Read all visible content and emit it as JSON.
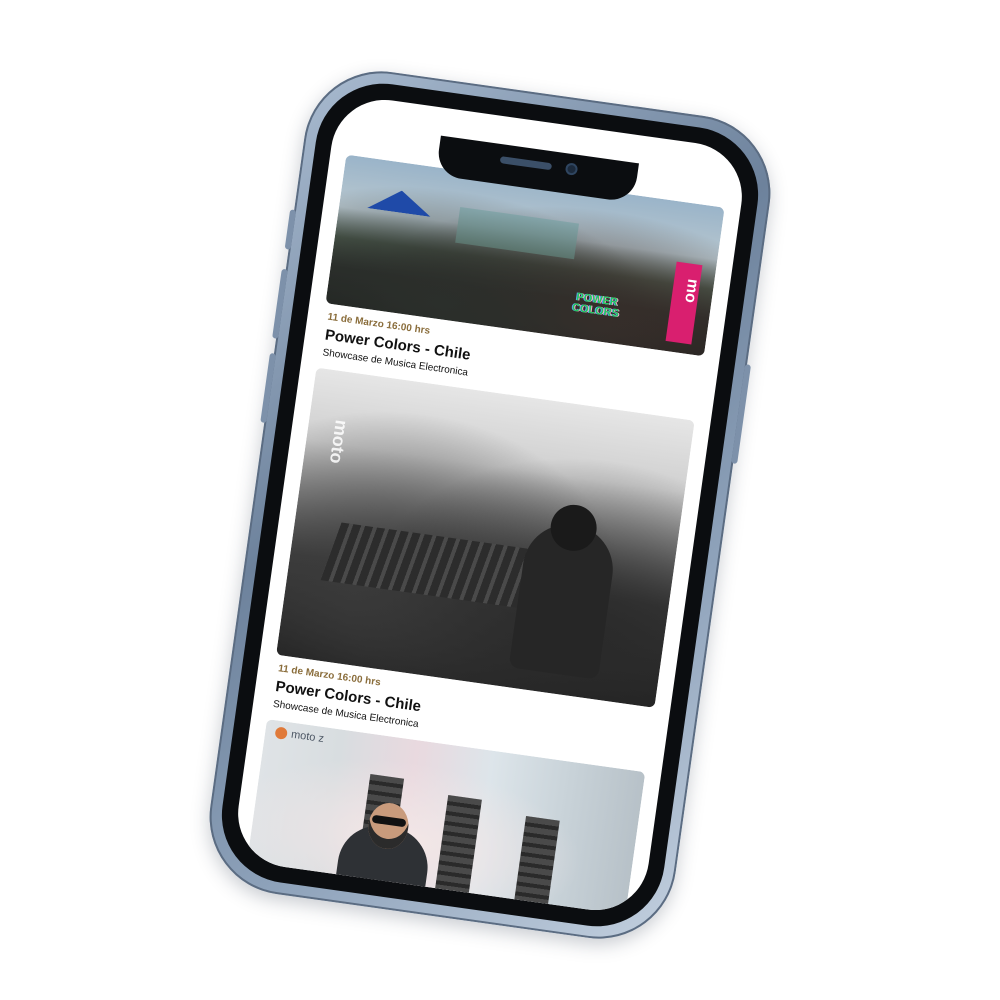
{
  "events": [
    {
      "date": "11 de Marzo 16:00 hrs",
      "title": "Power Colors - Chile",
      "subtitle": "Showcase de Musica Electronica",
      "image_overlays": {
        "banner": "mo",
        "logo_line1": "POWER",
        "logo_line2": "COLORS"
      }
    },
    {
      "date": "11 de Marzo 16:00 hrs",
      "title": "Power Colors - Chile",
      "subtitle": "Showcase de Musica Electronica",
      "image_overlays": {
        "tag": "moto"
      }
    },
    {
      "image_overlays": {
        "brand": "moto z"
      }
    }
  ],
  "colors": {
    "date": "#8a6d3b",
    "title": "#111111",
    "phone_frame": "#8fa3bb"
  }
}
